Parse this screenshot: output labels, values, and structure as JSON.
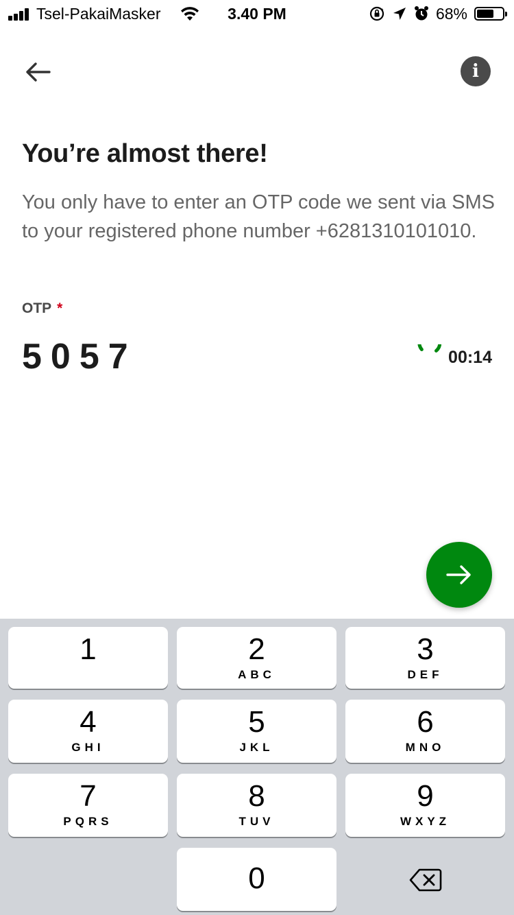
{
  "status_bar": {
    "carrier": "Tsel-PakaiMasker",
    "time": "3.40 PM",
    "battery": "68%",
    "battery_level": 0.68,
    "icons": [
      "signal-icon",
      "wifi-icon",
      "orientation-lock-icon",
      "location-icon",
      "alarm-icon",
      "battery-icon"
    ]
  },
  "header": {
    "back_icon": "arrow-left-icon",
    "info_icon": "info-icon",
    "info_glyph": "i"
  },
  "main": {
    "title": "You’re almost there!",
    "description": "You only have to enter an OTP code we sent via SMS to your registered phone number +6281310101010.",
    "otp_label": "OTP",
    "required_mark": "*",
    "otp_value": "5057",
    "timer": "00:14",
    "timer_progress": 0.75
  },
  "next_button": {
    "icon": "arrow-right-icon"
  },
  "keypad": {
    "keys": [
      {
        "num": "1",
        "letters": ""
      },
      {
        "num": "2",
        "letters": "ABC"
      },
      {
        "num": "3",
        "letters": "DEF"
      },
      {
        "num": "4",
        "letters": "GHI"
      },
      {
        "num": "5",
        "letters": "JKL"
      },
      {
        "num": "6",
        "letters": "MNO"
      },
      {
        "num": "7",
        "letters": "PQRS"
      },
      {
        "num": "8",
        "letters": "TUV"
      },
      {
        "num": "9",
        "letters": "WXYZ"
      },
      {
        "num": "0",
        "letters": ""
      }
    ],
    "backspace_icon": "backspace-icon"
  },
  "colors": {
    "accent_green": "#00880f",
    "required_red": "#d0021b",
    "keypad_bg": "#d1d4d9"
  }
}
